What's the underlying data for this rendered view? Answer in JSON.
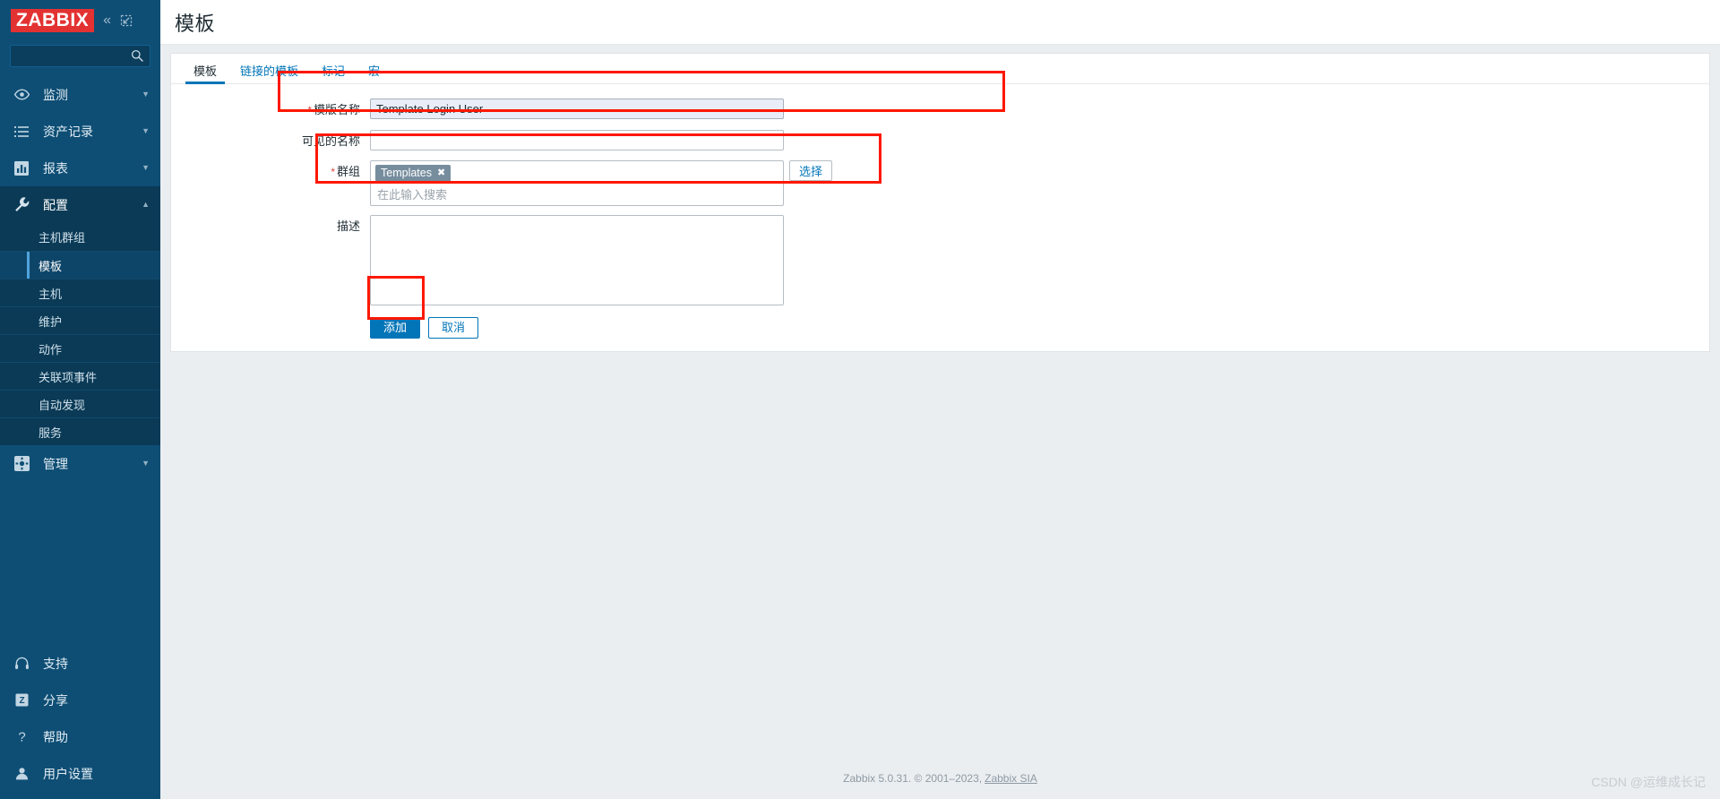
{
  "app": {
    "logo_text": "ZABBIX",
    "collapse_icon": "chevron-double-left-icon",
    "expand_icon": "expand-window-icon"
  },
  "search": {
    "value": "",
    "placeholder": "",
    "icon": "search-icon"
  },
  "sidebar": {
    "main_items": [
      {
        "label": "监测",
        "icon": "eye-icon",
        "has_chevron": true,
        "open": false
      },
      {
        "label": "资产记录",
        "icon": "list-icon",
        "has_chevron": true,
        "open": false
      },
      {
        "label": "报表",
        "icon": "bar-chart-icon",
        "has_chevron": true,
        "open": false
      },
      {
        "label": "配置",
        "icon": "wrench-icon",
        "has_chevron": true,
        "open": true
      }
    ],
    "submenu": [
      {
        "label": "主机群组",
        "active": false
      },
      {
        "label": "模板",
        "active": true
      },
      {
        "label": "主机",
        "active": false
      },
      {
        "label": "维护",
        "active": false
      },
      {
        "label": "动作",
        "active": false
      },
      {
        "label": "关联项事件",
        "active": false
      },
      {
        "label": "自动发现",
        "active": false
      },
      {
        "label": "服务",
        "active": false
      }
    ],
    "admin_item": {
      "label": "管理",
      "icon": "gear-icon",
      "has_chevron": true
    },
    "bottom_items": [
      {
        "label": "支持",
        "icon": "headset-icon"
      },
      {
        "label": "分享",
        "icon": "zabbix-share-icon"
      },
      {
        "label": "帮助",
        "icon": "question-mark-icon"
      },
      {
        "label": "用户设置",
        "icon": "user-icon"
      }
    ]
  },
  "header": {
    "title": "模板"
  },
  "tabs": [
    {
      "label": "模板",
      "active": true
    },
    {
      "label": "链接的模板",
      "active": false
    },
    {
      "label": "标记",
      "active": false
    },
    {
      "label": "宏",
      "active": false
    }
  ],
  "form": {
    "template_name": {
      "label": "模版名称",
      "required": true,
      "value": "Template Login User",
      "placeholder": ""
    },
    "visible_name": {
      "label": "可见的名称",
      "required": false,
      "value": "",
      "placeholder": ""
    },
    "groups": {
      "label": "群组",
      "required": true,
      "chips": [
        {
          "text": "Templates",
          "remove_icon": "close-icon"
        }
      ],
      "placeholder": "在此输入搜索",
      "select_button": "选择"
    },
    "description": {
      "label": "描述",
      "required": false,
      "value": "",
      "placeholder": ""
    },
    "submit_button": "添加",
    "cancel_button": "取消"
  },
  "footer": {
    "text": "Zabbix 5.0.31. © 2001–2023,",
    "link": "Zabbix SIA",
    "watermark": "CSDN @运维成长记"
  },
  "colors": {
    "sidebar_bg": "#0e4e75",
    "submenu_bg": "#0a3a56",
    "accent_link": "#0275b8",
    "logo_red": "#e33232",
    "annotation_red": "#fd1800",
    "required_star": "#d24a43",
    "chip_bg": "#768d9e",
    "focused_input_bg": "#e8edf7"
  }
}
